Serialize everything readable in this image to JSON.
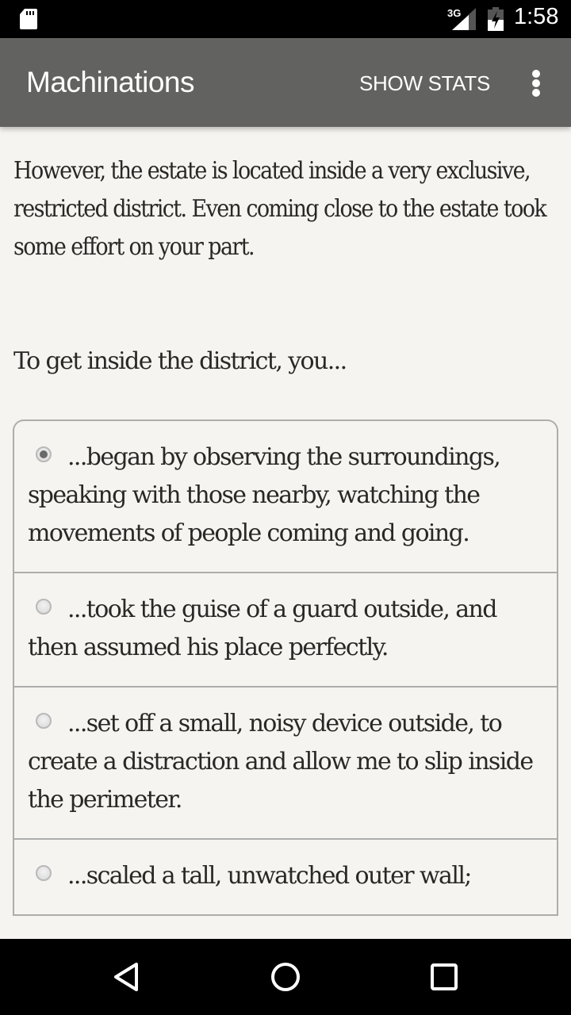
{
  "status_bar": {
    "sd_card_icon": "sd-card-icon",
    "network_type": "3G",
    "signal_icon": "cell-signal-icon",
    "battery_icon": "battery-charging-icon",
    "time": "1:58"
  },
  "toolbar": {
    "title": "Machinations",
    "show_stats_label": "SHOW STATS",
    "overflow_icon": "more-vert-icon"
  },
  "story": {
    "passage": "However, the estate is located inside a very exclusive, restricted district. Even coming close to the estate took some effort on your part.",
    "prompt": "To get inside the district, you..."
  },
  "choices": [
    {
      "text": "...began by observing the surroundings, speaking with those nearby, watching the movements of people coming and going.",
      "selected": true
    },
    {
      "text": "...took the guise of a guard outside, and then assumed his place perfectly.",
      "selected": false
    },
    {
      "text": "...set off a small, noisy device outside, to create a distraction and allow me to slip inside the perimeter.",
      "selected": false
    },
    {
      "text": "...scaled a tall, unwatched outer wall;",
      "selected": false
    }
  ],
  "nav_bar": {
    "back_icon": "back-icon",
    "home_icon": "home-icon",
    "recents_icon": "recents-icon"
  },
  "colors": {
    "toolbar_bg": "#626260",
    "page_bg": "#f6f4f1",
    "text": "#2a2826",
    "border": "#adadab"
  }
}
